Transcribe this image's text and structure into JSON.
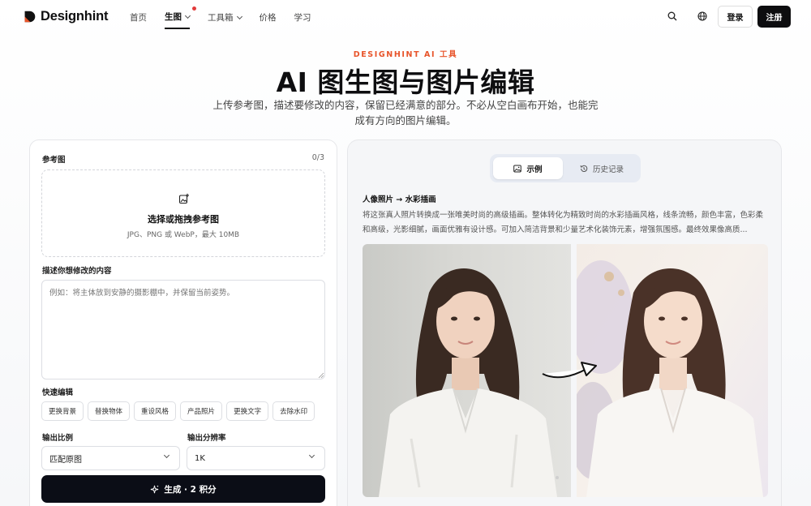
{
  "brand": {
    "name": "Designhint"
  },
  "nav": {
    "items": [
      {
        "label": "首页"
      },
      {
        "label": "生图"
      },
      {
        "label": "工具箱"
      },
      {
        "label": "价格"
      },
      {
        "label": "学习"
      }
    ],
    "login": "登录",
    "signup": "注册"
  },
  "hero": {
    "eyebrow": "DESIGNHINT AI 工具",
    "title": "AI 图生图与图片编辑",
    "subtitle": "上传参考图，描述要修改的内容，保留已经满意的部分。不必从空白画布开始，也能完成有方向的图片编辑。"
  },
  "form": {
    "ref_label": "参考图",
    "ref_count": "0/3",
    "upload_title": "选择或拖拽参考图",
    "upload_hint": "JPG、PNG 或 WebP，最大 10MB",
    "prompt_label": "描述你想修改的内容",
    "prompt_placeholder": "例如：将主体放到安静的摄影棚中，并保留当前姿势。",
    "quick_label": "快速编辑",
    "quick_chips": [
      {
        "label": "更换背景"
      },
      {
        "label": "替换物体"
      },
      {
        "label": "重设风格"
      },
      {
        "label": "产品照片"
      },
      {
        "label": "更换文字"
      },
      {
        "label": "去除水印"
      }
    ],
    "ratio_label": "输出比例",
    "ratio_value": "匹配原图",
    "resolution_label": "输出分辨率",
    "resolution_value": "1K",
    "generate_label": "生成 · 2 积分"
  },
  "examples": {
    "tabs": [
      {
        "label": "示例"
      },
      {
        "label": "历史记录"
      }
    ],
    "active_tab": "示例",
    "title": "人像照片 → 水彩插画",
    "description": "将这张真人照片转换成一张唯美时尚的高级插画。整体转化为精致时尚的水彩插画风格，线条流畅，颜色丰富，色彩柔和高级，光影细腻，画面优雅有设计感。可加入简洁背景和少量艺术化装饰元素，增强氛围感。最终效果像高质..."
  },
  "colors": {
    "accent": "#e8542a",
    "primary_dark": "#0b0d16",
    "notification": "#e23b3b"
  }
}
